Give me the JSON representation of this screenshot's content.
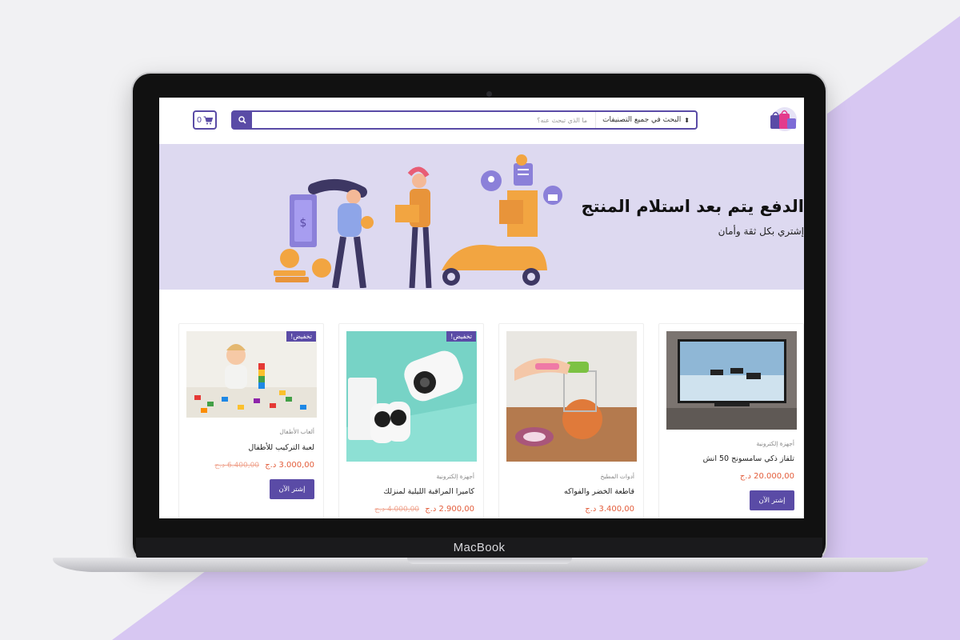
{
  "device_label": "MacBook",
  "header": {
    "search_placeholder": "ما الذي تبحث عنه؟",
    "category_select": "البحث في جميع التصنيفات",
    "cart_count": "0"
  },
  "banner": {
    "title": "الدفع يتم بعد استلام المنتج",
    "subtitle": "إشتري بكل ثقة وأمان"
  },
  "products": [
    {
      "category": "أجهزة إلكترونية",
      "title": "تلفاز ذكي سامسونج 50 انش",
      "price": "20.000,00 د.ج",
      "old_price": "",
      "badge": "",
      "button": "إشتر الآن"
    },
    {
      "category": "أدوات المطبخ",
      "title": "قاطعة الخضر والفواكه",
      "price": "3.400,00 د.ج",
      "old_price": "",
      "badge": "",
      "button": ""
    },
    {
      "category": "أجهزة إلكترونية",
      "title": "كاميرا المراقبة الليلية لمنزلك",
      "price": "2.900,00 د.ج",
      "old_price": "4.000,00 د.ج",
      "badge": "تخفيض!",
      "button": ""
    },
    {
      "category": "ألعاب الأطفال",
      "title": "لعبة التركيب للأطفال",
      "price": "3.000,00 د.ج",
      "old_price": "6.400,00 د.ج",
      "badge": "تخفيض!",
      "button": "إشتر الآن"
    }
  ],
  "colors": {
    "accent": "#5a4ba6",
    "banner_bg": "#ddd9f0",
    "price": "#e35d3b",
    "page_bg_triangle": "#d7c7f2"
  }
}
